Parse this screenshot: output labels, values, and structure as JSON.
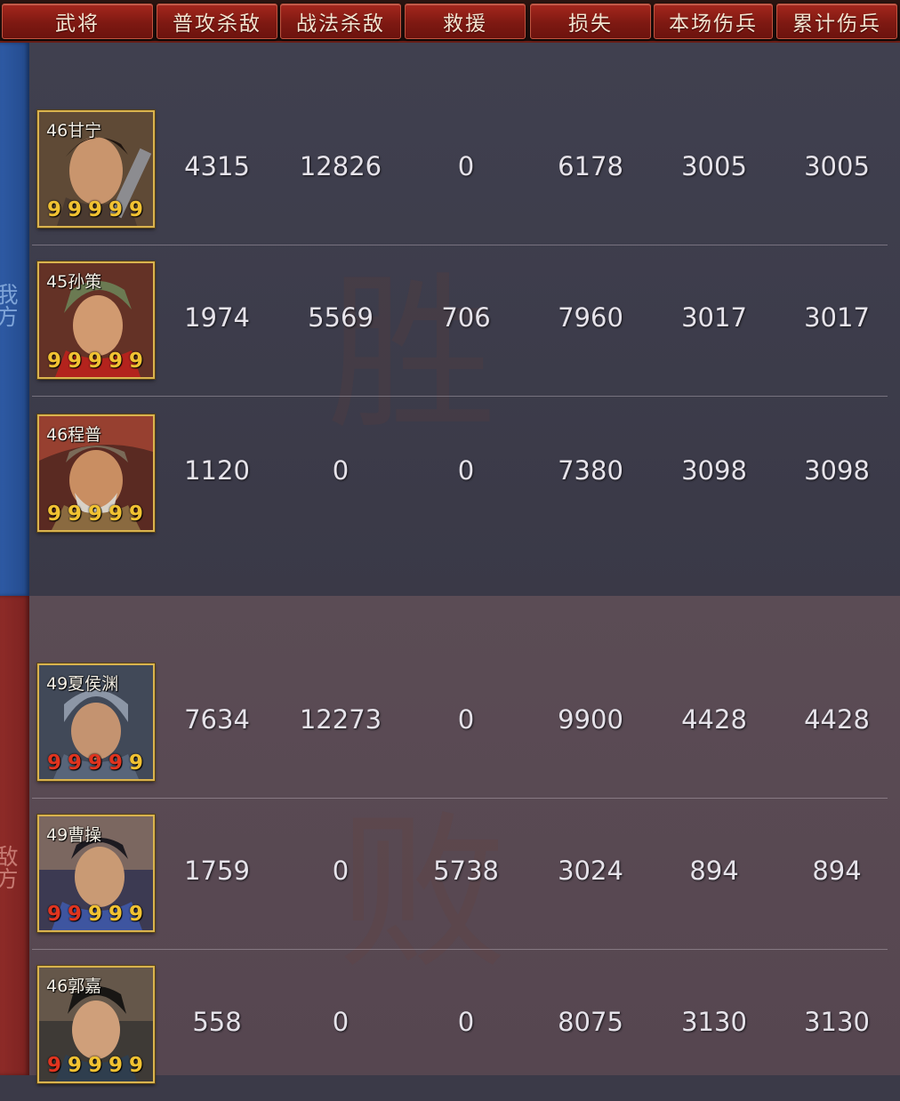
{
  "headers": [
    "武将",
    "普攻杀敌",
    "战法杀敌",
    "救援",
    "损失",
    "本场伤兵",
    "累计伤兵"
  ],
  "sides": {
    "ally": {
      "label": "我方",
      "watermark": "胜"
    },
    "enemy": {
      "label": "敌方",
      "watermark": "败"
    }
  },
  "ally_rows": [
    {
      "label": "46甘宁",
      "stars": [
        "9",
        "9",
        "9",
        "9",
        "9"
      ],
      "star_colors": [
        "gold",
        "gold",
        "gold",
        "gold",
        "gold"
      ],
      "normal_kills": "4315",
      "tactic_kills": "12826",
      "rescue": "0",
      "losses": "6178",
      "wounded_battle": "3005",
      "wounded_total": "3005"
    },
    {
      "label": "45孙策",
      "stars": [
        "9",
        "9",
        "9",
        "9",
        "9"
      ],
      "star_colors": [
        "gold",
        "gold",
        "gold",
        "gold",
        "gold"
      ],
      "normal_kills": "1974",
      "tactic_kills": "5569",
      "rescue": "706",
      "losses": "7960",
      "wounded_battle": "3017",
      "wounded_total": "3017"
    },
    {
      "label": "46程普",
      "stars": [
        "9",
        "9",
        "9",
        "9",
        "9"
      ],
      "star_colors": [
        "gold",
        "gold",
        "gold",
        "gold",
        "gold"
      ],
      "normal_kills": "1120",
      "tactic_kills": "0",
      "rescue": "0",
      "losses": "7380",
      "wounded_battle": "3098",
      "wounded_total": "3098"
    }
  ],
  "enemy_rows": [
    {
      "label": "49夏侯渊",
      "stars": [
        "9",
        "9",
        "9",
        "9",
        "9"
      ],
      "star_colors": [
        "red",
        "red",
        "red",
        "red",
        "gold"
      ],
      "normal_kills": "7634",
      "tactic_kills": "12273",
      "rescue": "0",
      "losses": "9900",
      "wounded_battle": "4428",
      "wounded_total": "4428"
    },
    {
      "label": "49曹操",
      "stars": [
        "9",
        "9",
        "9",
        "9",
        "9"
      ],
      "star_colors": [
        "red",
        "red",
        "gold",
        "gold",
        "gold"
      ],
      "normal_kills": "1759",
      "tactic_kills": "0",
      "rescue": "5738",
      "losses": "3024",
      "wounded_battle": "894",
      "wounded_total": "894"
    },
    {
      "label": "46郭嘉",
      "stars": [
        "9",
        "9",
        "9",
        "9",
        "9"
      ],
      "star_colors": [
        "red",
        "gold",
        "gold",
        "gold",
        "gold"
      ],
      "normal_kills": "558",
      "tactic_kills": "0",
      "rescue": "0",
      "losses": "8075",
      "wounded_battle": "3130",
      "wounded_total": "3130"
    }
  ],
  "colors": {
    "header_red": "#8e1f16",
    "ally_blue": "#2e5aa4",
    "enemy_red": "#8e2b28",
    "star_gold": "#f1c232",
    "star_red": "#e0341f"
  }
}
